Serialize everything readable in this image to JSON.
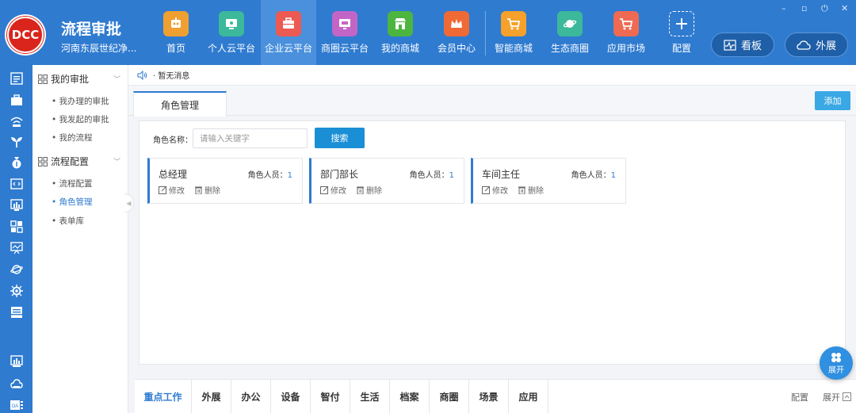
{
  "brand": {
    "logo_text": "DCC",
    "app_title": "流程审批",
    "company": "河南东辰世纪净..."
  },
  "window_controls": [
    "–",
    "▫",
    "⏻",
    "✕"
  ],
  "top_nav": [
    {
      "label": "首页",
      "icon": "robot-icon",
      "color": "#f0a030"
    },
    {
      "label": "个人云平台",
      "icon": "monitor-icon",
      "color": "#3cb89a"
    },
    {
      "label": "企业云平台",
      "icon": "briefcase-icon",
      "color": "#ec5a52",
      "active": true
    },
    {
      "label": "商圈云平台",
      "icon": "screen-icon",
      "color": "#c265c7"
    },
    {
      "label": "我的商城",
      "icon": "store-icon",
      "color": "#4cb53f"
    },
    {
      "label": "会员中心",
      "icon": "crown-icon",
      "color": "#ef6a35"
    },
    {
      "label": "智能商城",
      "icon": "cart-icon",
      "color": "#f5a12b"
    },
    {
      "label": "生态商圈",
      "icon": "planet-icon",
      "color": "#3cb89a"
    },
    {
      "label": "应用市场",
      "icon": "cart-icon",
      "color": "#ef6a52"
    },
    {
      "label": "配置",
      "icon": "plus-icon",
      "color": "#2f7bd0"
    }
  ],
  "header_buttons": {
    "dashboard": "看板",
    "expand": "外展"
  },
  "icon_sidebar": [
    "list-icon",
    "briefcase-icon",
    "wifi-icon",
    "sprout-icon",
    "moneybag-icon",
    "code-icon",
    "chart-icon",
    "grid-icon",
    "presentation-icon",
    "planet-icon",
    "gear-icon",
    "inbox-icon",
    "chart-icon",
    "cloud-icon",
    "oa-icon"
  ],
  "sidebar": {
    "groups": [
      {
        "label": "我的审批",
        "items": [
          {
            "label": "我办理的审批"
          },
          {
            "label": "我发起的审批"
          },
          {
            "label": "我的流程"
          }
        ]
      },
      {
        "label": "流程配置",
        "items": [
          {
            "label": "流程配置"
          },
          {
            "label": "角色管理",
            "active": true
          },
          {
            "label": "表单库"
          }
        ]
      }
    ]
  },
  "notice": {
    "text": "· 暂无消息"
  },
  "tabs": {
    "active": "角色管理",
    "add": "添加"
  },
  "search": {
    "label": "角色名称：",
    "placeholder": "请输入关键字",
    "button": "搜索"
  },
  "roles": {
    "count_label": "角色人员：",
    "edit_label": "修改",
    "delete_label": "删除",
    "items": [
      {
        "name": "总经理",
        "count": "1"
      },
      {
        "name": "部门部长",
        "count": "1"
      },
      {
        "name": "车间主任",
        "count": "1"
      }
    ]
  },
  "bottom_tabs": [
    "重点工作",
    "外展",
    "办公",
    "设备",
    "智付",
    "生活",
    "档案",
    "商圈",
    "场景",
    "应用"
  ],
  "bottom_actions": {
    "config": "配置",
    "expand": "展开"
  },
  "fab": {
    "label": "展开"
  }
}
